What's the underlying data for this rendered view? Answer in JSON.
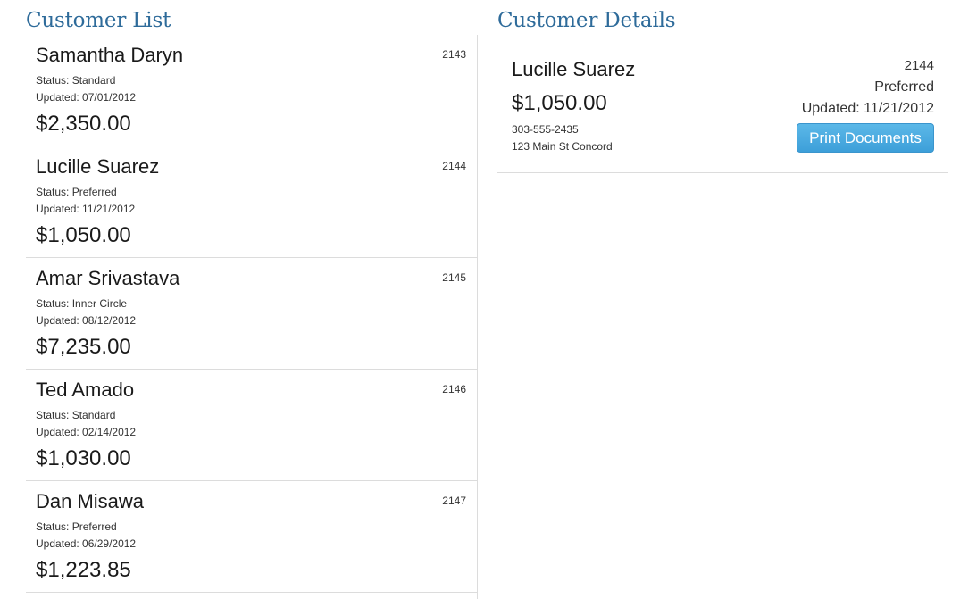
{
  "customer_list": {
    "title": "Customer List",
    "items": [
      {
        "name": "Samantha Daryn",
        "id": "2143",
        "status": "Status: Standard",
        "updated": "Updated: 07/01/2012",
        "amount": "$2,350.00"
      },
      {
        "name": "Lucille Suarez",
        "id": "2144",
        "status": "Status: Preferred",
        "updated": "Updated: 11/21/2012",
        "amount": "$1,050.00"
      },
      {
        "name": "Amar Srivastava",
        "id": "2145",
        "status": "Status: Inner Circle",
        "updated": "Updated: 08/12/2012",
        "amount": "$7,235.00"
      },
      {
        "name": "Ted Amado",
        "id": "2146",
        "status": "Status: Standard",
        "updated": "Updated: 02/14/2012",
        "amount": "$1,030.00"
      },
      {
        "name": "Dan Misawa",
        "id": "2147",
        "status": "Status: Preferred",
        "updated": "Updated: 06/29/2012",
        "amount": "$1,223.85"
      }
    ]
  },
  "customer_details": {
    "title": "Customer Details",
    "name": "Lucille Suarez",
    "amount": "$1,050.00",
    "phone": "303-555-2435",
    "address": "123 Main St Concord",
    "id": "2144",
    "status": "Preferred",
    "updated": "Updated: 11/21/2012",
    "print_button_label": "Print Documents"
  },
  "colors": {
    "title": "#2e6b9a",
    "button": "#3d9fd9",
    "divider": "#dcdcdc"
  }
}
